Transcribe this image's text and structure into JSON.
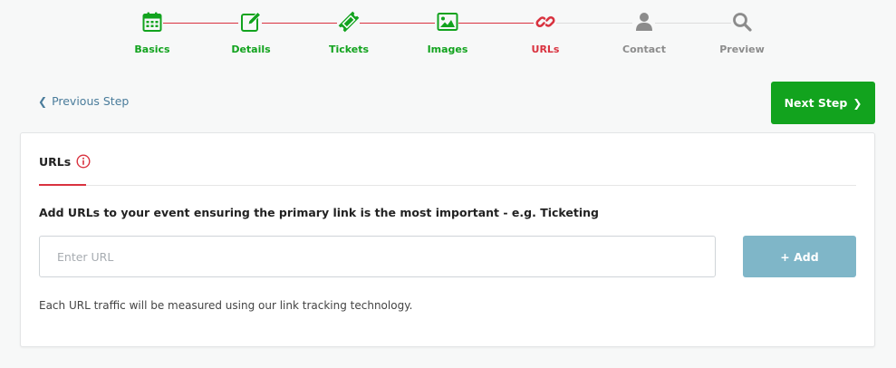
{
  "stepper": {
    "steps": [
      {
        "label": "Basics",
        "icon": "calendar-icon",
        "state": "done"
      },
      {
        "label": "Details",
        "icon": "edit-icon",
        "state": "done"
      },
      {
        "label": "Tickets",
        "icon": "ticket-icon",
        "state": "done"
      },
      {
        "label": "Images",
        "icon": "image-icon",
        "state": "done"
      },
      {
        "label": "URLs",
        "icon": "link-icon",
        "state": "active"
      },
      {
        "label": "Contact",
        "icon": "user-icon",
        "state": "pending"
      },
      {
        "label": "Preview",
        "icon": "search-icon",
        "state": "pending"
      }
    ],
    "colors": {
      "done": "#12a31e",
      "active": "#d9323f",
      "pending": "#8c8c8c",
      "line_done": "#d9323f",
      "line_pending": "#dcdcdc"
    }
  },
  "nav": {
    "prev_label": "Previous Step",
    "next_label": "Next Step"
  },
  "card": {
    "tab_label": "URLs",
    "description": "Add URLs to your event ensuring the primary link is the most important - e.g. Ticketing",
    "input": {
      "value": "",
      "placeholder": "Enter URL"
    },
    "add_label": "+ Add",
    "note": "Each URL traffic will be measured using our link tracking technology."
  },
  "colors": {
    "primary_green": "#12a31e",
    "accent_red": "#d9323f",
    "link_blue": "#4a7c9b",
    "disabled_button": "#7fb6c8"
  }
}
